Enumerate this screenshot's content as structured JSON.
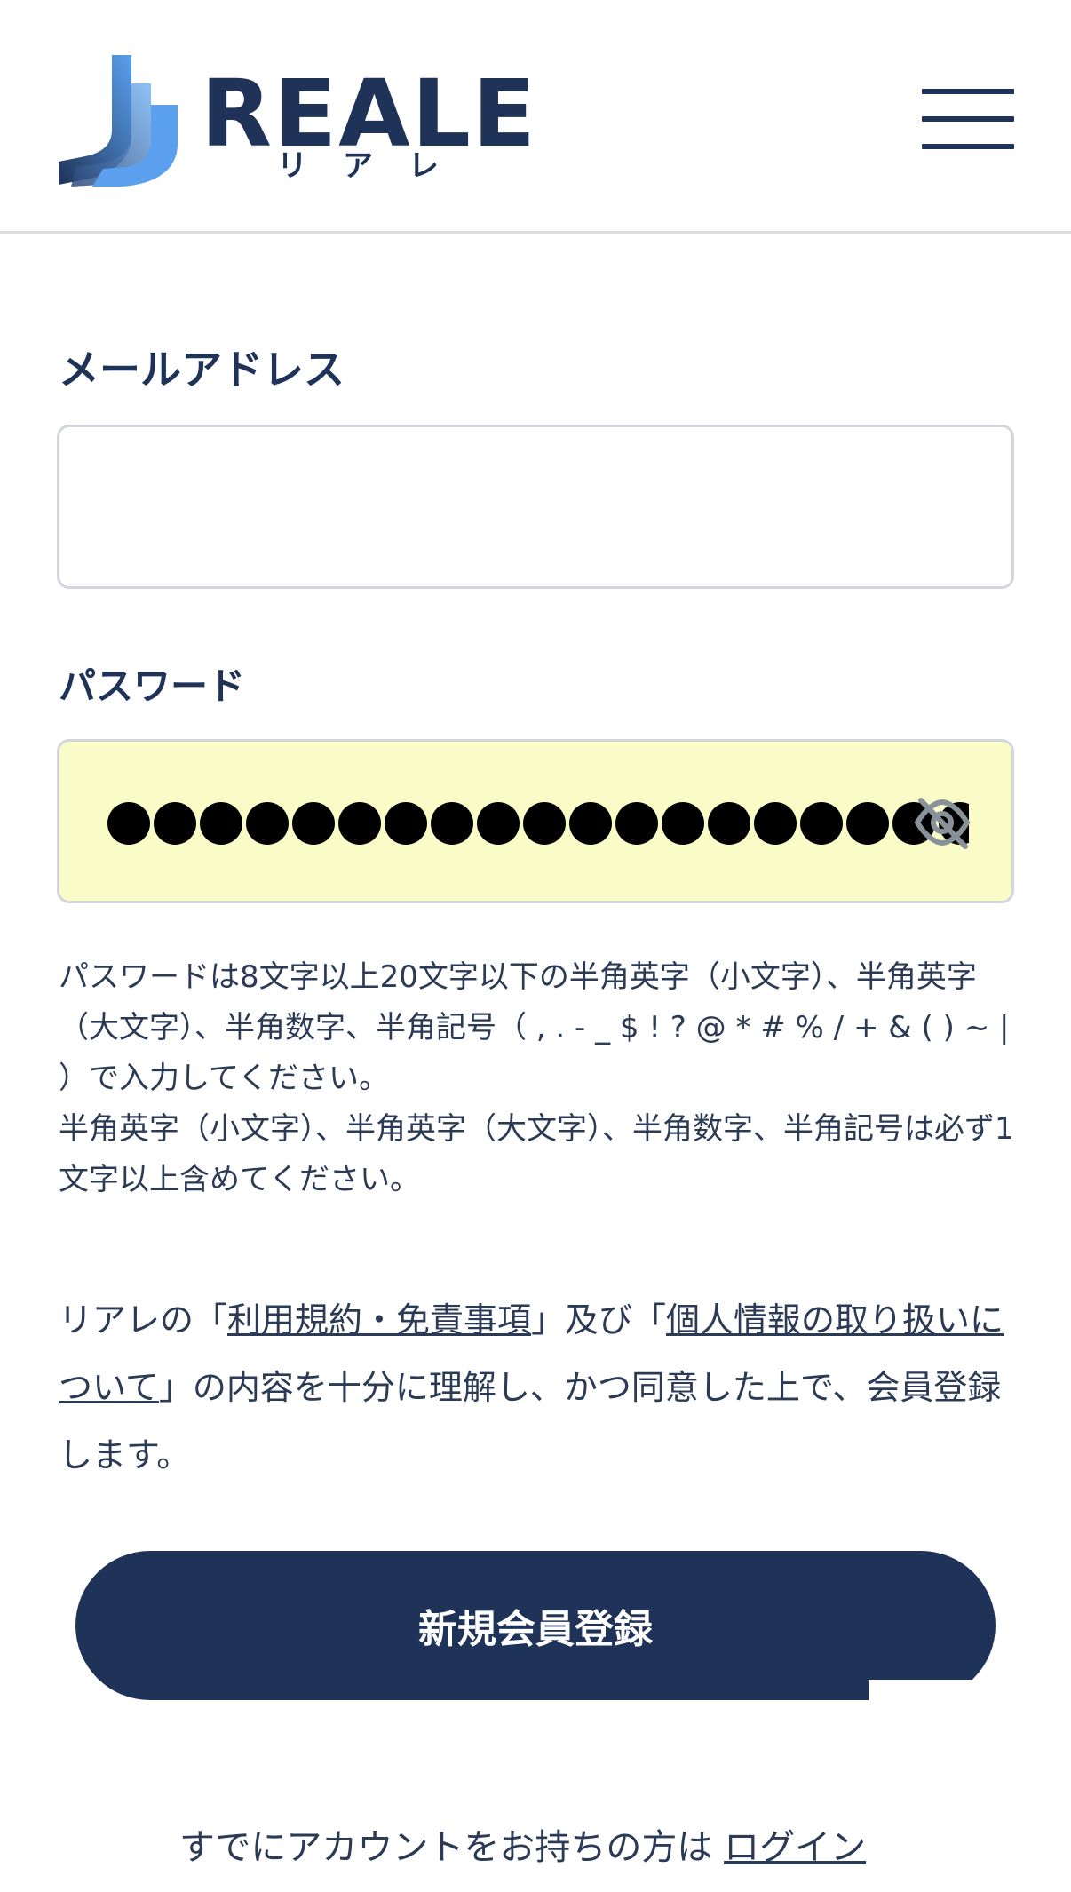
{
  "header": {
    "logo_text": "REALE",
    "logo_subtext": "リアレ",
    "colors": {
      "primary": "#1f3358",
      "accent": "#4a8fe0"
    },
    "menu_icon": "hamburger-menu-icon"
  },
  "form": {
    "email": {
      "label": "メールアドレス",
      "value": ""
    },
    "password": {
      "label": "パスワード",
      "masked_dot_count": 20,
      "toggle_icon": "eye-slash-icon",
      "autofill_background": "#fafcc8"
    },
    "help_line1": "パスワードは8文字以上20文字以下の半角英字（小文字）、半角英字（大文字）、半角数字、半角記号（ , . - _ $ ! ? @ * # % / + & ( ) ~ | ）で入力してください。",
    "help_line2": "半角英字（小文字）、半角英字（大文字）、半角数字、半角記号は必ず1文字以上含めてください。"
  },
  "agreement": {
    "prefix": "リアレの「",
    "terms_link": "利用規約・免責事項",
    "middle": "」及び「",
    "privacy_link": "個人情報の取り扱いについて",
    "suffix": "」の内容を十分に理解し、かつ同意した上で、会員登録します。"
  },
  "register_button": {
    "label": "新規会員登録"
  },
  "login": {
    "text": "すでにアカウントをお持ちの方は ",
    "link": "ログイン"
  }
}
